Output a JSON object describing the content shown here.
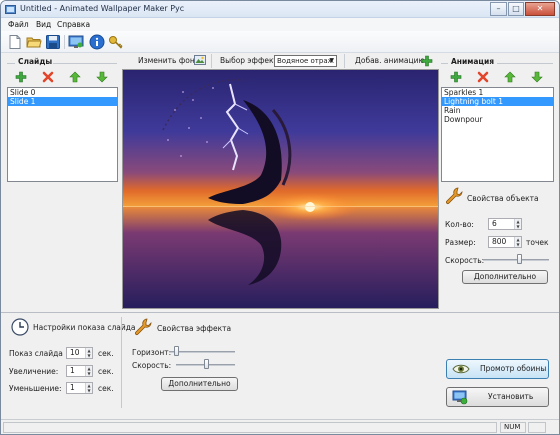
{
  "window": {
    "title": "Untitled - Animated Wallpaper Maker Рус"
  },
  "menu": [
    "Файл",
    "Вид",
    "Справка"
  ],
  "toolbar_icons": [
    "new-file-icon",
    "open-folder-icon",
    "save-icon",
    "monitor-icon",
    "info-icon",
    "key-icon"
  ],
  "slides": {
    "title": "Слайды",
    "items": [
      "Slide 0",
      "Slide 1"
    ],
    "selected_index": 1
  },
  "preview_bar": {
    "change_bg_label": "Изменить фон",
    "effect_select_label": "Выбор эффекта",
    "effect_value": "Водяное отраж",
    "add_anim_label": "Добав. анимацию"
  },
  "animation": {
    "title": "Анимация",
    "items": [
      "Sparkles 1",
      "Lightning bolt 1",
      "Rain",
      "Downpour"
    ],
    "selected_index": 1
  },
  "object_props": {
    "title": "Свойства объекта",
    "count_label": "Кол-во:",
    "count_value": "6",
    "size_label": "Размер:",
    "size_value": "800",
    "size_unit": "точек",
    "speed_label": "Скорость:",
    "speed_level": 0.55,
    "more_button": "Дополнительно"
  },
  "slideshow": {
    "title": "Настройки показа слайда",
    "show_label": "Показ слайда",
    "show_value": "10",
    "zoom_in_label": "Увеличение:",
    "zoom_in_value": "1",
    "zoom_out_label": "Уменьшение:",
    "zoom_out_value": "1",
    "unit": "сек."
  },
  "effect_props": {
    "title": "Свойства эффекта",
    "horizon_label": "Горизонт:",
    "horizon_level": 0.08,
    "speed_label": "Скорость:",
    "speed_level": 0.52,
    "more_button": "Дополнительно"
  },
  "actions": {
    "preview_button": "Промотр обоины",
    "install_button": "Установить"
  },
  "status": {
    "num": "NUM"
  }
}
